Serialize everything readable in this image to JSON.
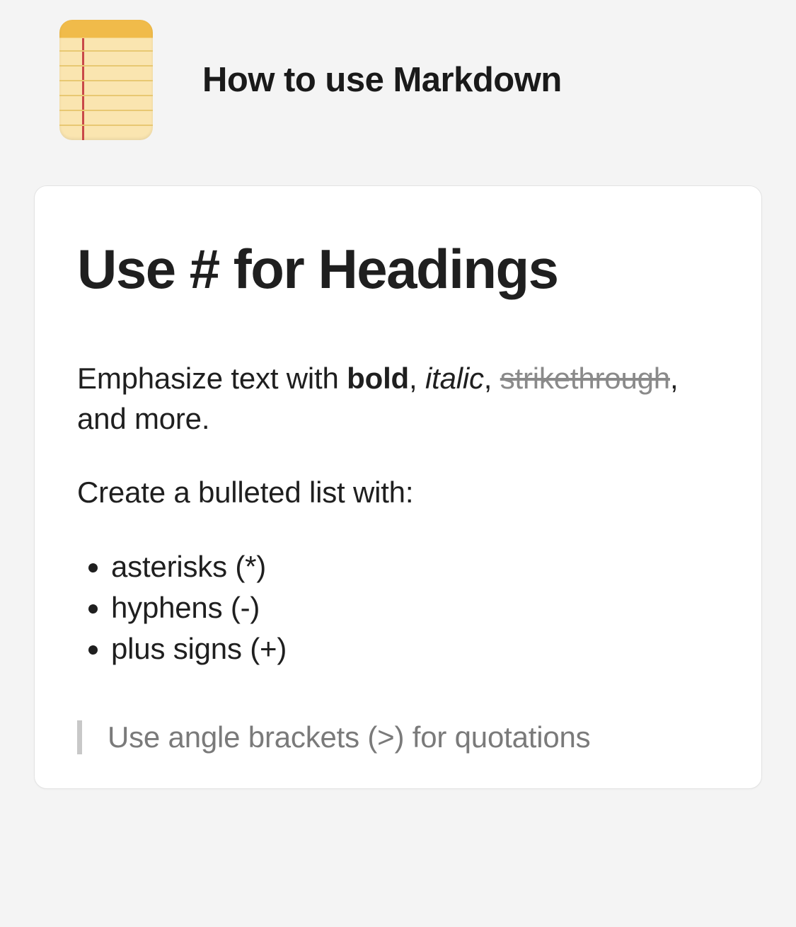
{
  "header": {
    "title": "How to use Markdown"
  },
  "card": {
    "heading": "Use # for Headings",
    "emphasize": {
      "prefix": "Emphasize text with ",
      "bold": "bold",
      "sep1": ", ",
      "italic": "italic",
      "sep2": ", ",
      "strike": "strikethrough",
      "suffix": ", and more."
    },
    "list_intro": "Create a bulleted list with:",
    "bullets": [
      "asterisks (*)",
      "hyphens (-)",
      "plus signs (+)"
    ],
    "quote": "Use angle brackets (>) for quotations"
  }
}
